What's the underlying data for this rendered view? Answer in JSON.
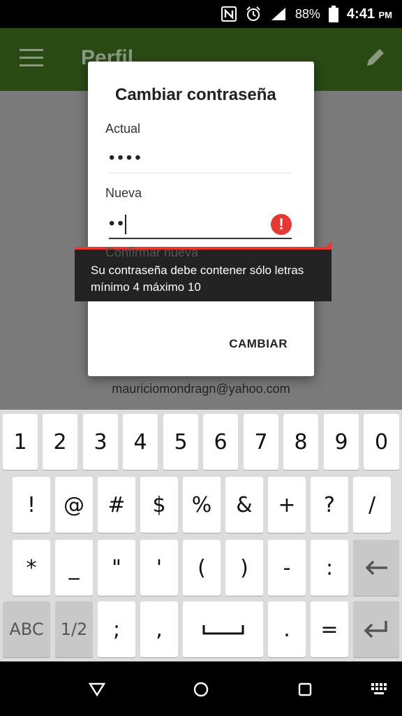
{
  "status_bar": {
    "battery": "88%",
    "time": "4:41",
    "ampm": "PM"
  },
  "app_bar": {
    "title": "Perfil"
  },
  "profile": {
    "email": "mauriciomondragn@yahoo.com"
  },
  "dialog": {
    "title": "Cambiar contraseña",
    "current_label": "Actual",
    "current_value": "••••",
    "new_label": "Nueva",
    "new_value": "••",
    "confirm_label": "Confirmar nueva",
    "button_label": "CAMBIAR"
  },
  "error": {
    "line1": "Su contraseña debe contener sólo letras",
    "line2": "mínimo 4 máximo 10",
    "color": "#e53935"
  },
  "keyboard": {
    "row1": [
      "1",
      "2",
      "3",
      "4",
      "5",
      "6",
      "7",
      "8",
      "9",
      "0"
    ],
    "row2": [
      "!",
      "@",
      "#",
      "$",
      "%",
      "&",
      "+",
      "?",
      "/"
    ],
    "row3": [
      "*",
      "_",
      "\"",
      "'",
      "(",
      ")",
      "-",
      ":"
    ],
    "row4": [
      ";",
      ",",
      ".",
      "="
    ],
    "abc_label": "ABC",
    "page_label": "1/2"
  }
}
